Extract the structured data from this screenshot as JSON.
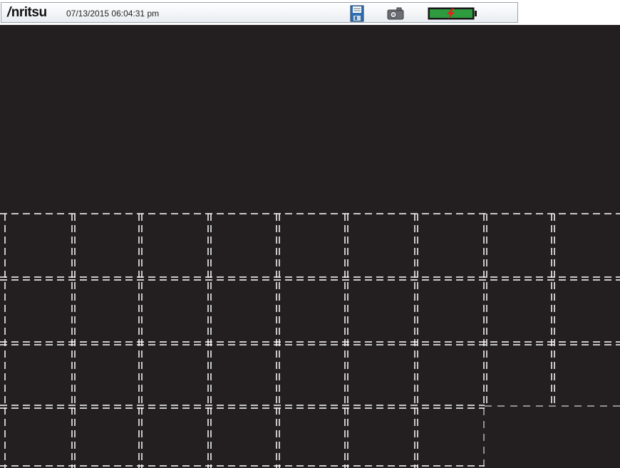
{
  "status_bar": {
    "brand": "Anritsu",
    "brand_prefix": "/",
    "brand_rest": "nritsu",
    "datetime": "07/13/2015 06:04:31 pm",
    "icons": [
      "save-icon",
      "camera-icon",
      "battery-charging-icon"
    ]
  },
  "colors": {
    "screen_background": "#231f20",
    "grid_line": "#ffffff",
    "battery_fill": "#2e9b3f",
    "charge_bolt": "#e2231a",
    "save_icon_blue": "#2f6fb3"
  },
  "battery": {
    "level_percent": 100,
    "charging": true
  }
}
